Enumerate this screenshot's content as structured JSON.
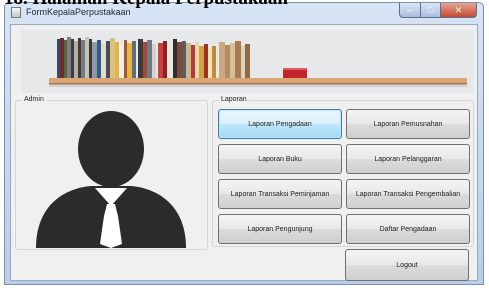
{
  "heading": "18. Halaman Kepala Perpustakaan",
  "window": {
    "title": "FormKepalaPerpustakaan",
    "controls": {
      "minimize": "–",
      "maximize": "□",
      "close": "✕"
    }
  },
  "admin": {
    "label": "Admin",
    "avatar": "user-silhouette-icon"
  },
  "laporan": {
    "label": "Laporan",
    "buttons": [
      {
        "label": "Laporan Pengadaan"
      },
      {
        "label": "Laporan Pemusnahan"
      },
      {
        "label": "Laporan Buku"
      },
      {
        "label": "Laporan Pelanggaran"
      },
      {
        "label": "Laporan Transaksi Peminjaman"
      },
      {
        "label": "Laporan Transaksi Pengembalian"
      },
      {
        "label": "Laporan Pengunjung"
      },
      {
        "label": "Daftar Pengadaan"
      }
    ]
  },
  "logout": {
    "label": "Logout"
  },
  "colors": {
    "window_frame": "#b9cde8",
    "client": "#f0f0f0",
    "avatar": "#2b2b2b",
    "focus": "#3c7fb1"
  }
}
